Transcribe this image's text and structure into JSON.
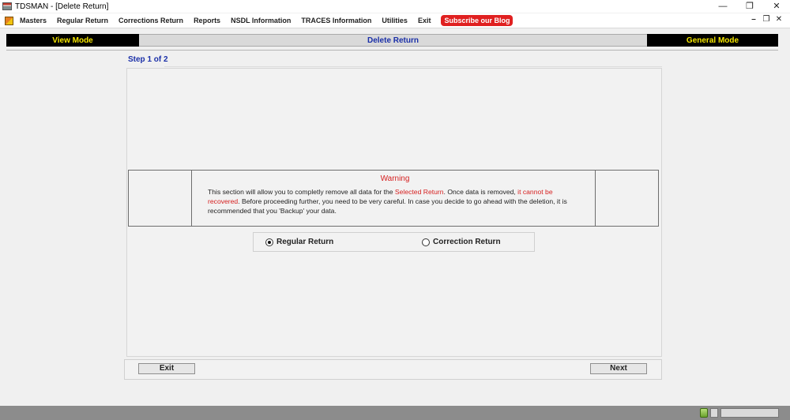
{
  "window": {
    "title": "TDSMAN - [Delete Return]",
    "controls": {
      "minimize": "—",
      "restore": "❐",
      "close": "✕"
    }
  },
  "menu": {
    "items": [
      "Masters",
      "Regular Return",
      "Corrections Return",
      "Reports",
      "NSDL Information",
      "TRACES Information",
      "Utilities",
      "Exit"
    ],
    "subscribe": "Subscribe our Blog",
    "mdi_controls": {
      "minimize": "–",
      "restore": "❐",
      "close": "✕"
    }
  },
  "header": {
    "left": "View Mode",
    "center": "Delete Return",
    "right": "General Mode"
  },
  "step": {
    "label": "Step 1 of 2"
  },
  "warning": {
    "title": "Warning",
    "text_1": "This section will allow you to completly remove all data for the ",
    "highlight_1": "Selected Return",
    "text_2": ". Once data is removed, ",
    "highlight_2": "it cannot be recovered",
    "text_3": ". Before proceeding further, you need to be very careful. In case you decide to go ahead with the deletion, it is recommended that you 'Backup' your data."
  },
  "return_type": {
    "options": [
      {
        "label": "Regular Return",
        "checked": true
      },
      {
        "label": "Correction Return",
        "checked": false
      }
    ]
  },
  "buttons": {
    "exit": "Exit",
    "next": "Next"
  },
  "colors": {
    "header_dark": "#000000",
    "header_text": "#f5e600",
    "accent_blue": "#1a2fa8",
    "warning_red": "#d62020",
    "subscribe_red": "#e02020"
  }
}
